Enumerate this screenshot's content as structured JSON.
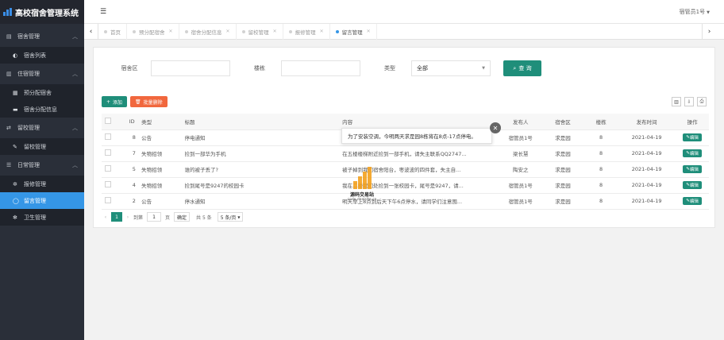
{
  "app": {
    "brand": "高校宿舍管理系统"
  },
  "sidebar": {
    "groups": [
      {
        "label": "宿舍管理",
        "icon": "building-icon",
        "items": [
          {
            "label": "宿舍列表",
            "icon": "cube-icon"
          }
        ]
      },
      {
        "label": "住宿管理",
        "icon": "bar-chart-icon",
        "items": [
          {
            "label": "预分配宿舍",
            "icon": "barcode-icon"
          },
          {
            "label": "宿舍分配信息",
            "icon": "bed-icon"
          }
        ]
      },
      {
        "label": "留校管理",
        "icon": "exchange-icon",
        "items": [
          {
            "label": "留校管理",
            "icon": "edit-icon"
          }
        ]
      },
      {
        "label": "日常管理",
        "icon": "list-icon",
        "items": [
          {
            "label": "报修管理",
            "icon": "gear-icon"
          },
          {
            "label": "留言管理",
            "icon": "comment-icon",
            "active": true
          },
          {
            "label": "卫生管理",
            "icon": "cog-icon"
          }
        ]
      }
    ]
  },
  "topbar": {
    "user": "宿管员1号"
  },
  "tabs": [
    {
      "label": "首页",
      "close": false
    },
    {
      "label": "预分配宿舍",
      "close": true
    },
    {
      "label": "宿舍分配信息",
      "close": true
    },
    {
      "label": "留校管理",
      "close": true
    },
    {
      "label": "报修管理",
      "close": true
    },
    {
      "label": "留言管理",
      "close": true,
      "active": true
    }
  ],
  "search": {
    "area_label": "宿舍区",
    "building_label": "楼栋",
    "type_label": "类型",
    "type_value": "全部",
    "button": "查 询"
  },
  "toolbar": {
    "add": "添加",
    "batch_delete": "批量删除"
  },
  "table": {
    "headers": [
      "ID",
      "类型",
      "标题",
      "内容",
      "发布人",
      "宿舍区",
      "楼栋",
      "发布时间",
      "操作"
    ],
    "rows": [
      {
        "id": "8",
        "type": "公告",
        "title": "停电通知",
        "content": "",
        "author": "宿管员1号",
        "area": "求是园",
        "building": "8",
        "date": "2021-04-19",
        "action": "编辑"
      },
      {
        "id": "7",
        "type": "失物招领",
        "title": "捡到一部华为手机",
        "content": "在五楼楼梯附近捡到一部手机，请失主联系QQ2747...",
        "author": "梁长慧",
        "area": "求是园",
        "building": "8",
        "date": "2021-04-19",
        "action": "编辑"
      },
      {
        "id": "5",
        "type": "失物招领",
        "title": "谁的被子丢了?",
        "content": "被子掉到我们宿舍阳台，枣波波的四件套，失主自...",
        "author": "陶安之",
        "area": "求是园",
        "building": "8",
        "date": "2021-04-19",
        "action": "编辑"
      },
      {
        "id": "4",
        "type": "失物招领",
        "title": "捡到尾号是9247的校园卡",
        "content": "我在二楼我们处捡到一张校园卡，尾号是9247，请...",
        "author": "宿管员1号",
        "area": "求是园",
        "building": "8",
        "date": "2021-04-19",
        "action": "编辑"
      },
      {
        "id": "2",
        "type": "公告",
        "title": "停水通知",
        "content": "明天早上8点到后天下午6点停水，请同学们注意囤...",
        "author": "宿管员1号",
        "area": "求是园",
        "building": "8",
        "date": "2021-04-19",
        "action": "编辑"
      }
    ]
  },
  "pager": {
    "page": "1",
    "goto_prefix": "到第",
    "goto_value": "1",
    "goto_suffix": "页",
    "confirm": "确定",
    "total": "共 5 条",
    "size": "5 条/页"
  },
  "tooltip": {
    "text": "为了安装空调，今明两天求是园8栋将在8点-17点停电。"
  },
  "watermark": {
    "text": "源码交易站",
    "url": "code.dealsite.cn"
  }
}
